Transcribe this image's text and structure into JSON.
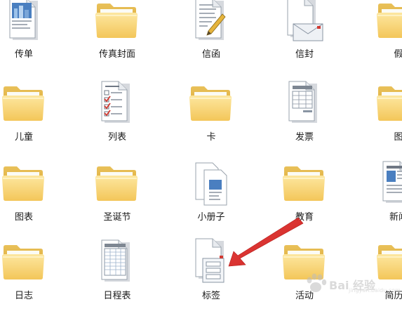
{
  "templates": [
    {
      "label": "传单",
      "icon": "flyer-document-icon"
    },
    {
      "label": "传真封面",
      "icon": "folder-icon"
    },
    {
      "label": "信函",
      "icon": "letter-document-icon"
    },
    {
      "label": "信封",
      "icon": "envelope-document-icon"
    },
    {
      "label": "假",
      "icon": "folder-icon"
    },
    {
      "label": "儿童",
      "icon": "folder-icon"
    },
    {
      "label": "列表",
      "icon": "checklist-document-icon"
    },
    {
      "label": "卡",
      "icon": "folder-icon"
    },
    {
      "label": "发票",
      "icon": "invoice-document-icon"
    },
    {
      "label": "图",
      "icon": "folder-icon"
    },
    {
      "label": "图表",
      "icon": "folder-icon"
    },
    {
      "label": "圣诞节",
      "icon": "folder-icon"
    },
    {
      "label": "小册子",
      "icon": "brochure-document-icon"
    },
    {
      "label": "教育",
      "icon": "folder-icon"
    },
    {
      "label": "新闻",
      "icon": "newsletter-document-icon"
    },
    {
      "label": "日志",
      "icon": "folder-icon"
    },
    {
      "label": "日程表",
      "icon": "schedule-document-icon"
    },
    {
      "label": "标签",
      "icon": "label-document-icon"
    },
    {
      "label": "活动",
      "icon": "folder-icon"
    },
    {
      "label": "简历和",
      "icon": "folder-icon"
    }
  ],
  "annotation": {
    "color": "#e8322f"
  },
  "watermark": {
    "text": "Bai 经验",
    "sub": "jingyan.baidu.com"
  }
}
